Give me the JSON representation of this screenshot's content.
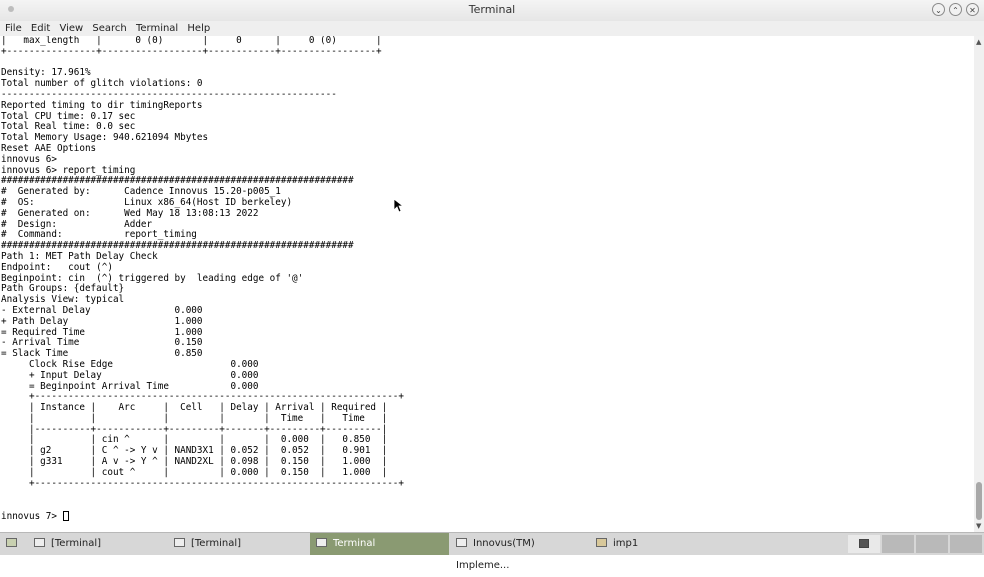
{
  "window": {
    "title": "Terminal",
    "controls": {
      "minimize": "⌄",
      "maximize": "⌃",
      "close": "✕"
    }
  },
  "menu": [
    "File",
    "Edit",
    "View",
    "Search",
    "Terminal",
    "Help"
  ],
  "terminal": {
    "lines": [
      "|   max_length   |      0 (0)       |     0      |     0 (0)       |",
      "+----------------+------------------+------------+-----------------+",
      "",
      "Density: 17.961%",
      "Total number of glitch violations: 0",
      "------------------------------------------------------------",
      "Reported timing to dir timingReports",
      "Total CPU time: 0.17 sec",
      "Total Real time: 0.0 sec",
      "Total Memory Usage: 940.621094 Mbytes",
      "Reset AAE Options",
      "innovus 6>",
      "innovus 6> report_timing",
      "###############################################################",
      "#  Generated by:      Cadence Innovus 15.20-p005_1",
      "#  OS:                Linux x86_64(Host ID berkeley)",
      "#  Generated on:      Wed May 18 13:08:13 2022",
      "#  Design:            Adder",
      "#  Command:           report_timing",
      "###############################################################",
      "Path 1: MET Path Delay Check",
      "Endpoint:   cout (^)",
      "Beginpoint: cin  (^) triggered by  leading edge of '@'",
      "Path Groups: {default}",
      "Analysis View: typical",
      "- External Delay               0.000",
      "+ Path Delay                   1.000",
      "= Required Time                1.000",
      "- Arrival Time                 0.150",
      "= Slack Time                   0.850",
      "     Clock Rise Edge                     0.000",
      "     + Input Delay                       0.000",
      "     = Beginpoint Arrival Time           0.000",
      "     +-----------------------------------------------------------------+",
      "     | Instance |    Arc     |  Cell   | Delay | Arrival | Required |",
      "     |          |            |         |       |  Time   |   Time   |",
      "     |----------+------------+---------+-------+---------+----------|",
      "     |          | cin ^      |         |       |  0.000  |   0.850  |",
      "     | g2       | C ^ -> Y v | NAND3X1 | 0.052 |  0.052  |   0.901  |",
      "     | g331     | A v -> Y ^ | NAND2XL | 0.098 |  0.150  |   1.000  |",
      "     |          | cout ^     |         | 0.000 |  0.150  |   1.000  |",
      "     +-----------------------------------------------------------------+",
      "",
      ""
    ],
    "prompt": "innovus 7> "
  },
  "taskbar": {
    "items": [
      {
        "label": "[Terminal]",
        "icon": "terminal-icon"
      },
      {
        "label": "[Terminal]",
        "icon": "terminal-icon"
      },
      {
        "label": "Terminal",
        "icon": "terminal-icon"
      },
      {
        "label": "Innovus(TM) Impleme...",
        "icon": "window-icon"
      },
      {
        "label": "imp1",
        "icon": "folder-icon"
      }
    ]
  },
  "colors": {
    "active_task": "#8a9a72",
    "taskbar": "#d7d7d7"
  }
}
